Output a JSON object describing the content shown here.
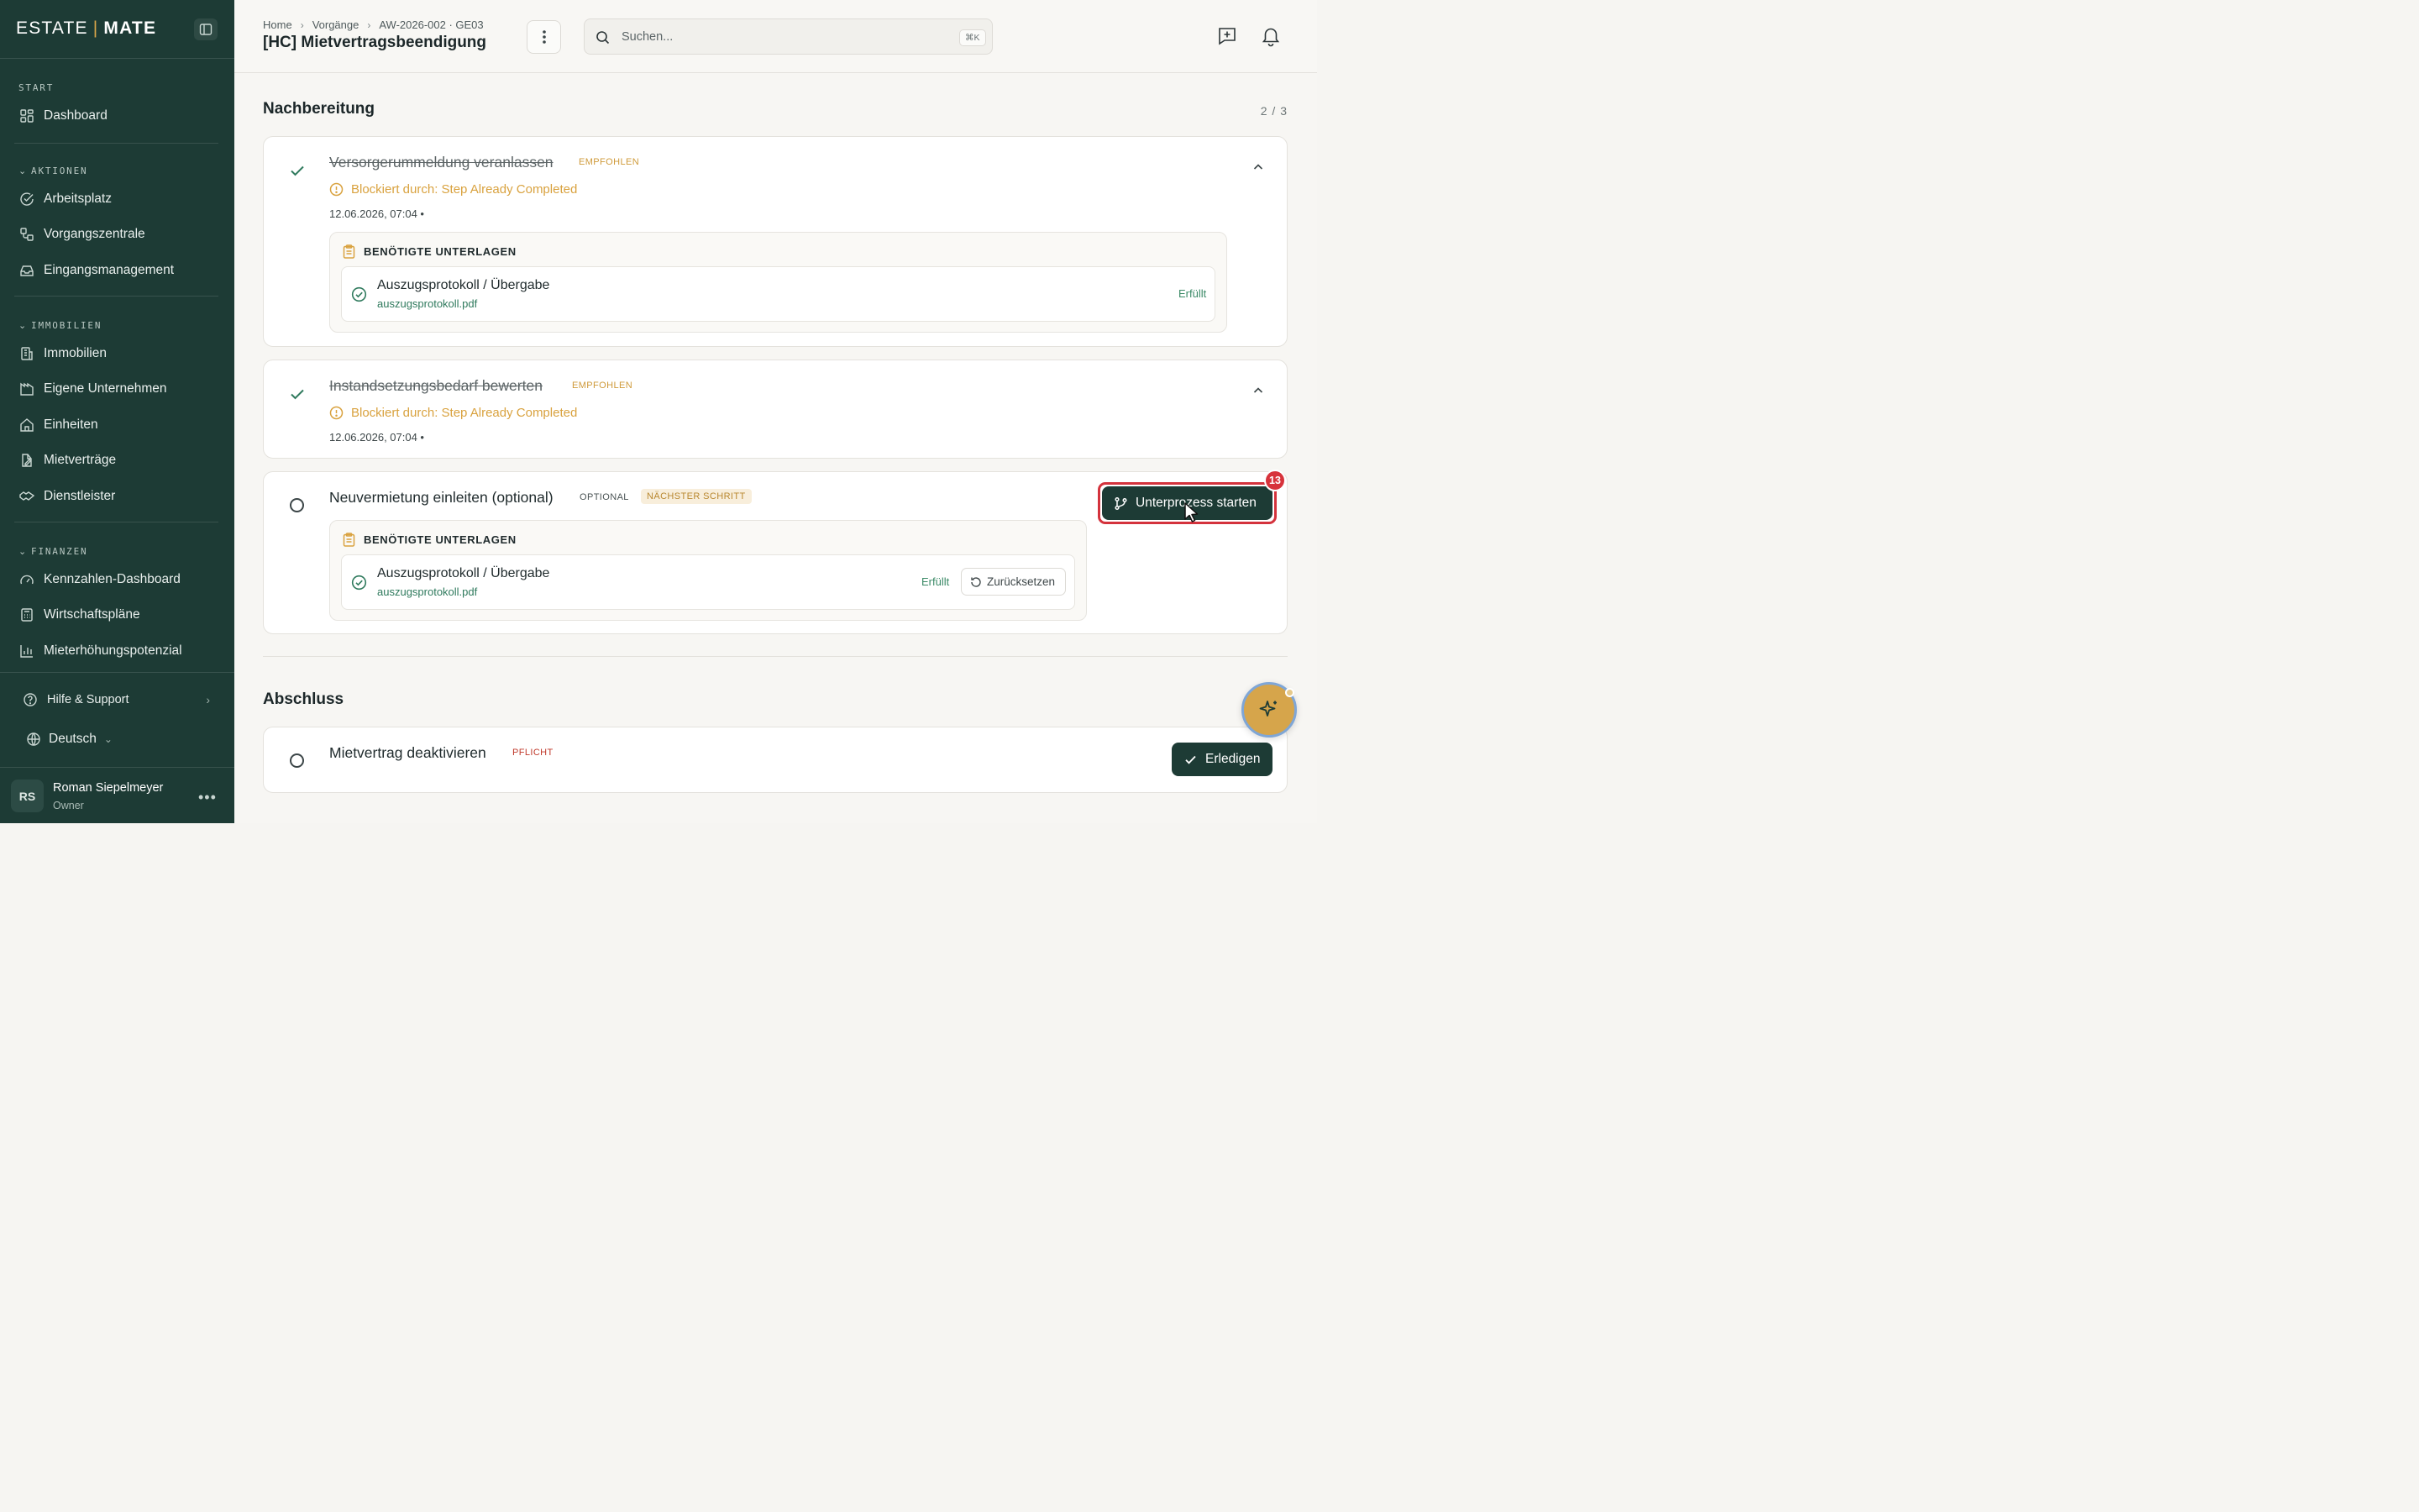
{
  "app": {
    "logo_left": "ESTATE",
    "logo_sep": "|",
    "logo_right": "MATE"
  },
  "sidebar": {
    "start_label": "START",
    "dashboard": "Dashboard",
    "aktionen_label": "AKTIONEN",
    "aktionen": [
      "Arbeitsplatz",
      "Vorgangszentrale",
      "Eingangsmanagement"
    ],
    "immobilien_label": "IMMOBILIEN",
    "immobilien": [
      "Immobilien",
      "Eigene Unternehmen",
      "Einheiten",
      "Mietverträge",
      "Dienstleister"
    ],
    "finanzen_label": "FINANZEN",
    "finanzen": [
      "Kennzahlen-Dashboard",
      "Wirtschaftspläne",
      "Mieterhöhungspotenzial"
    ],
    "help": "Hilfe & Support",
    "language": "Deutsch",
    "user": {
      "initials": "RS",
      "name": "Roman Siepelmeyer",
      "role": "Owner"
    }
  },
  "header": {
    "breadcrumb": [
      "Home",
      "Vorgänge",
      "AW-2026-002 · GE03"
    ],
    "title": "[HC] Mietvertragsbeendigung",
    "search_placeholder": "Suchen...",
    "search_shortcut": "⌘K"
  },
  "nachbereitung": {
    "title": "Nachbereitung",
    "progress": "2 / 3",
    "steps": [
      {
        "title": "Versorgerummeldung veranlassen",
        "badge": "EMPFOHLEN",
        "blocked": "Blockiert durch: Step Already Completed",
        "timestamp": "12.06.2026, 07:04  •",
        "docs_header": "BENÖTIGTE UNTERLAGEN",
        "doc_name": "Auszugsprotokoll / Übergabe",
        "doc_file": "auszugsprotokoll.pdf",
        "doc_status": "Erfüllt"
      },
      {
        "title": "Instandsetzungsbedarf bewerten",
        "badge": "EMPFOHLEN",
        "blocked": "Blockiert durch: Step Already Completed",
        "timestamp": "12.06.2026, 07:04  •"
      },
      {
        "title": "Neuvermietung einleiten (optional)",
        "badge_optional": "OPTIONAL",
        "badge_next": "NÄCHSTER SCHRITT",
        "docs_header": "BENÖTIGTE UNTERLAGEN",
        "doc_name": "Auszugsprotokoll / Übergabe",
        "doc_file": "auszugsprotokoll.pdf",
        "doc_status": "Erfüllt",
        "reset_label": "Zurücksetzen",
        "action_label": "Unterprozess starten",
        "action_count": "13"
      }
    ]
  },
  "abschluss": {
    "title": "Abschluss",
    "step_title": "Mietvertrag deaktivieren",
    "badge": "PFLICHT",
    "action_label": "Erledigen"
  },
  "colors": {
    "sidebar_bg": "#1d3b35",
    "accent_gold": "#d6a54b",
    "success_green": "#3b8a67",
    "danger_red": "#d7333b"
  }
}
